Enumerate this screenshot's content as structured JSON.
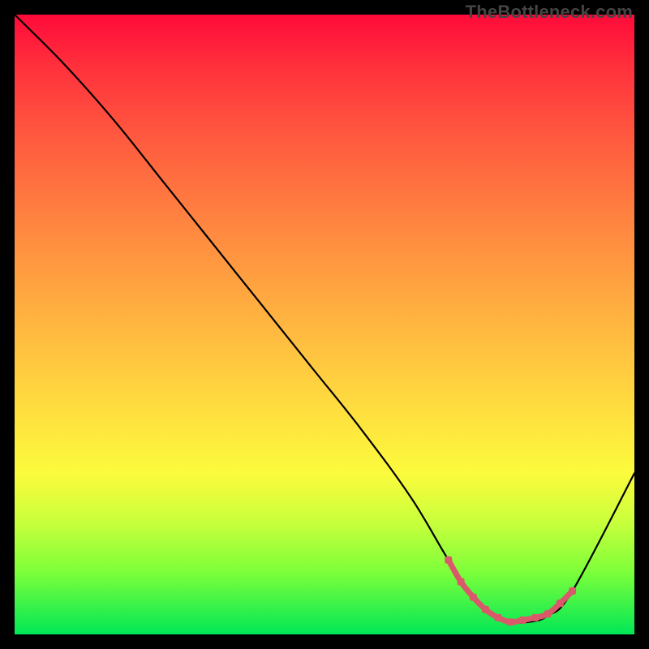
{
  "watermark": "TheBottleneck.com",
  "chart_data": {
    "type": "line",
    "title": "",
    "xlabel": "",
    "ylabel": "",
    "xlim": [
      0,
      100
    ],
    "ylim": [
      0,
      100
    ],
    "series": [
      {
        "name": "bottleneck-curve",
        "x": [
          0,
          8,
          16,
          24,
          32,
          40,
          48,
          56,
          64,
          70,
          74,
          77,
          80,
          83,
          86,
          90,
          100
        ],
        "values": [
          100,
          92,
          83,
          73,
          63,
          53,
          43,
          33,
          22,
          12,
          6,
          3,
          2,
          2,
          3,
          7,
          26
        ]
      }
    ],
    "highlight": {
      "name": "optimal-range",
      "color": "#d9596b",
      "x": [
        70,
        72,
        74,
        76,
        78,
        80,
        82,
        84,
        86,
        88,
        90
      ],
      "values": [
        12,
        8.5,
        6,
        4,
        2.7,
        2,
        2.3,
        2.7,
        3.3,
        5,
        7
      ]
    }
  }
}
